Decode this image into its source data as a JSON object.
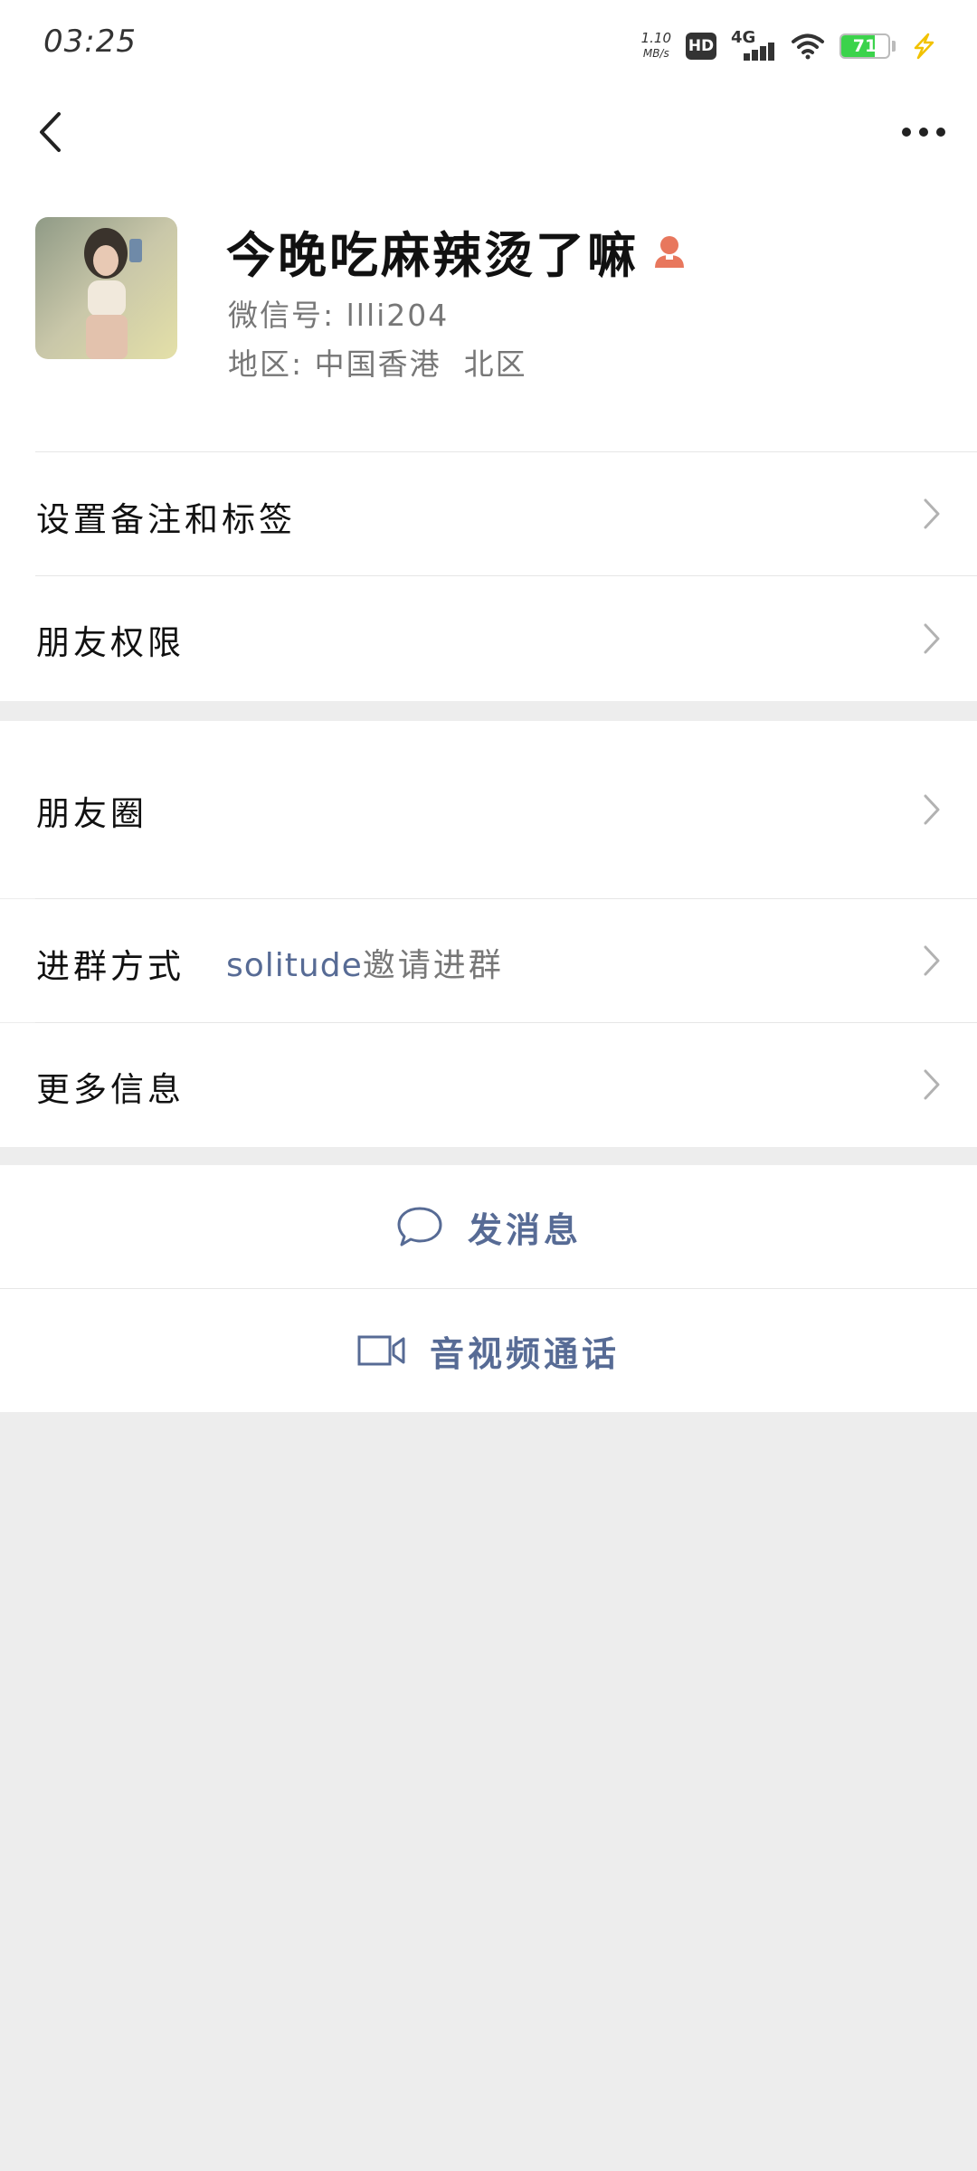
{
  "status_bar": {
    "time": "03:25",
    "net_speed_value": "1.10",
    "net_speed_unit": "MB/s",
    "hd_badge": "HD",
    "network": "4G",
    "battery_percent": "71",
    "icons": [
      "hd-icon",
      "signal-icon",
      "wifi-icon",
      "battery-icon",
      "charging-icon"
    ]
  },
  "nav": {
    "back_icon": "back-chevron-icon",
    "more_icon": "more-dots-icon"
  },
  "profile": {
    "name": "今晚吃麻辣烫了嘛",
    "gender_icon": "female-icon",
    "gender_color": "#e8775d",
    "wechat_id": "微信号: llli204",
    "region": "地区: 中国香港  北区"
  },
  "menu_section_1": [
    {
      "label": "设置备注和标签"
    },
    {
      "label": "朋友权限"
    }
  ],
  "menu_section_2": {
    "moments": {
      "label": "朋友圈"
    },
    "join_method": {
      "label": "进群方式",
      "inviter": "solitude",
      "suffix": "邀请进群"
    },
    "more_info": {
      "label": "更多信息"
    }
  },
  "actions": {
    "send_message": {
      "label": "发消息",
      "icon": "chat-bubble-icon"
    },
    "av_call": {
      "label": "音视频通话",
      "icon": "video-camera-icon"
    }
  },
  "colors": {
    "link_blue": "#576b95",
    "page_gray": "#ededed",
    "battery_green": "#3bd34b"
  }
}
